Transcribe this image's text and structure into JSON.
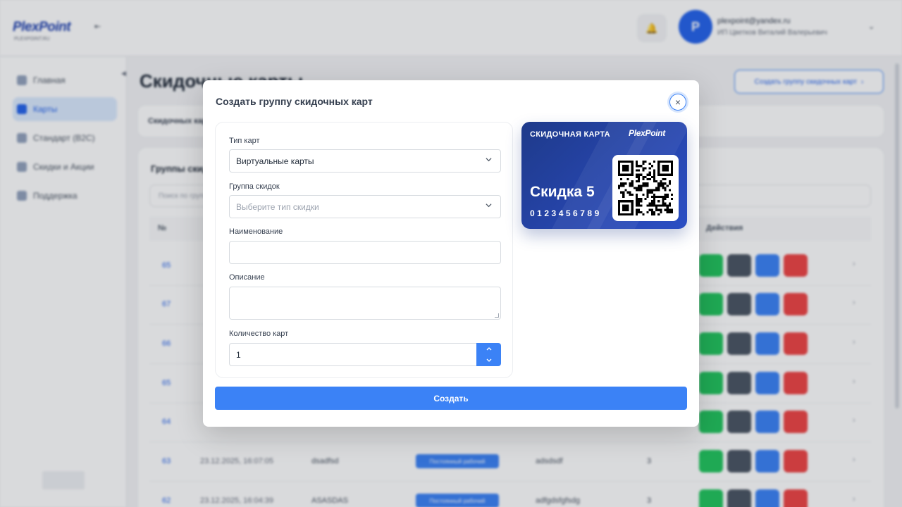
{
  "header": {
    "logo": "PlexPoint",
    "logo_subtitle": "PLEXPOINT.RU",
    "user_email": "plexpoint@yandex.ru",
    "user_name": "ИП Цветков Виталий Валерьевич"
  },
  "sidebar": {
    "items": [
      {
        "label": "Главная"
      },
      {
        "label": "Карты"
      },
      {
        "label": "Стандарт (B2C)"
      },
      {
        "label": "Скидки и Акции"
      },
      {
        "label": "Поддержка"
      }
    ],
    "active_index": 1
  },
  "page": {
    "title": "Скидочные карты",
    "create_group_button": "Создать группу скидочных карт",
    "stat_label": "Скидочных карт",
    "list_title": "Группы скидочных карт",
    "search_placeholder": "Поиск по группам",
    "col_id": "№",
    "col_actions": "Действия",
    "rows": [
      {
        "id": "65",
        "date": "",
        "code": "",
        "badge": "",
        "name": "",
        "count": ""
      },
      {
        "id": "67",
        "date": "",
        "code": "",
        "badge": "",
        "name": "",
        "count": ""
      },
      {
        "id": "66",
        "date": "",
        "code": "",
        "badge": "",
        "name": "",
        "count": ""
      },
      {
        "id": "65",
        "date": "",
        "code": "",
        "badge": "",
        "name": "",
        "count": ""
      },
      {
        "id": "64",
        "date": "",
        "code": "",
        "badge": "",
        "name": "",
        "count": ""
      },
      {
        "id": "63",
        "date": "23.12.2025, 16:07:05",
        "code": "dsadfsd",
        "badge": "Постоянный рабочий",
        "name": "adsdsdf",
        "count": "3"
      },
      {
        "id": "62",
        "date": "23.12.2025, 16:04:39",
        "code": "ASASDAS",
        "badge": "Постоянный рабочий",
        "name": "adfgdsfgfsdg",
        "count": "3"
      }
    ]
  },
  "modal": {
    "title": "Создать группу скидочных карт",
    "fields": {
      "card_type": {
        "label": "Тип карт",
        "value": "Виртуальные карты"
      },
      "discount_group": {
        "label": "Группа скидок",
        "placeholder": "Выберите тип скидки"
      },
      "name": {
        "label": "Наименование",
        "value": ""
      },
      "description": {
        "label": "Описание",
        "value": ""
      },
      "quantity": {
        "label": "Количество карт",
        "value": "1"
      }
    },
    "card_preview": {
      "title": "СКИДОЧНАЯ КАРТА",
      "logo": "PlexPoint",
      "discount_name": "Скидка 5",
      "number": "0123456789"
    },
    "submit_label": "Создать"
  },
  "colors": {
    "accent": "#3b82f6",
    "card_dark": "#1e3a8a",
    "card_light": "#2b4ec4",
    "action_green": "#22c55e",
    "action_gray": "#4b5563",
    "action_blue": "#3b82f6",
    "action_red": "#ef4444"
  },
  "icons": [
    "chevron-down-icon",
    "close-icon",
    "chevron-up-icon",
    "bell-icon",
    "qr-code-icon"
  ]
}
